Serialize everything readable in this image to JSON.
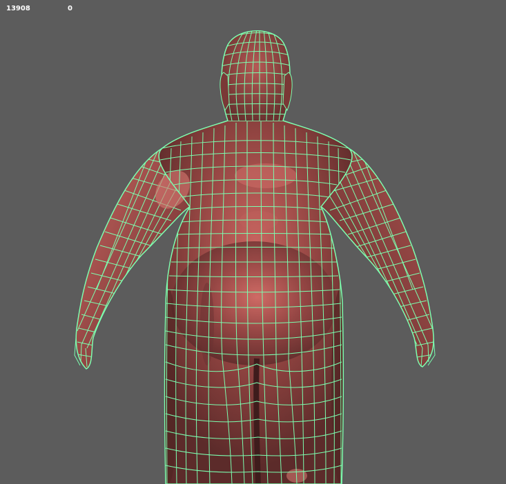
{
  "viewport": {
    "hud": {
      "poly_count": "13908",
      "second_value": "0"
    },
    "background_color": "#5c5c5c",
    "wire_color": "#7cffb0",
    "skin_color": "#9e4b48",
    "skin_highlight": "#d8807a",
    "skin_shadow": "#5a2a2a"
  }
}
